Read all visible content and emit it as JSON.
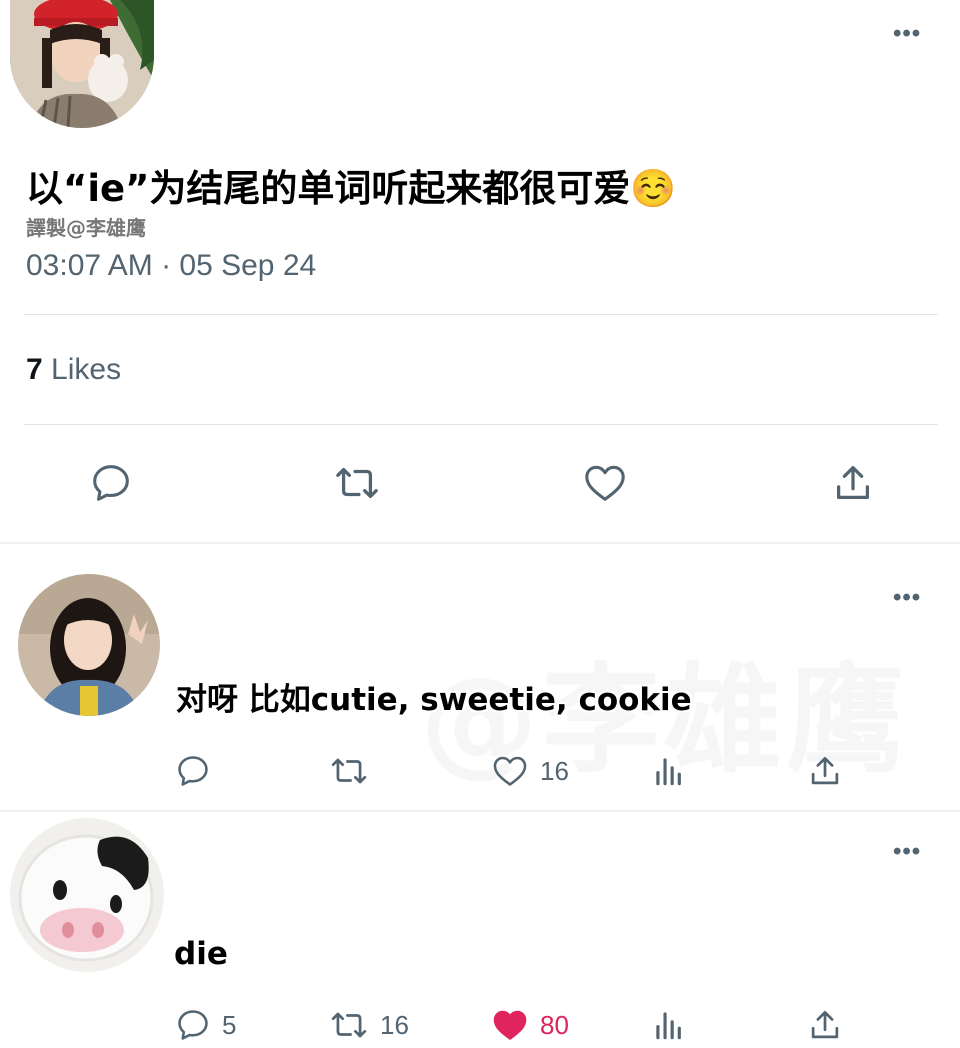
{
  "tweet": {
    "text": "以“ie”为结尾的单词听起来都很可爱☺️",
    "credit": "譯製@李雄鹰",
    "timestamp": "03:07 AM · 05 Sep 24",
    "likes_count": "7",
    "likes_label": "Likes",
    "actions": [
      "reply",
      "retweet",
      "like",
      "share"
    ]
  },
  "replies": [
    {
      "text": "对呀 比如cutie, sweetie, cookie",
      "reply_count": "",
      "retweet_count": "",
      "like_count": "16",
      "liked": false
    },
    {
      "text": "die",
      "reply_count": "5",
      "retweet_count": "16",
      "like_count": "80",
      "liked": true
    }
  ],
  "watermark": "@李雄鹰",
  "icons": [
    "more-icon",
    "reply-icon",
    "retweet-icon",
    "like-icon",
    "views-icon",
    "share-icon"
  ],
  "colors": {
    "text": "#0f1419",
    "muted": "#536471",
    "like": "#f91880",
    "divider": "#e3e6e8"
  }
}
